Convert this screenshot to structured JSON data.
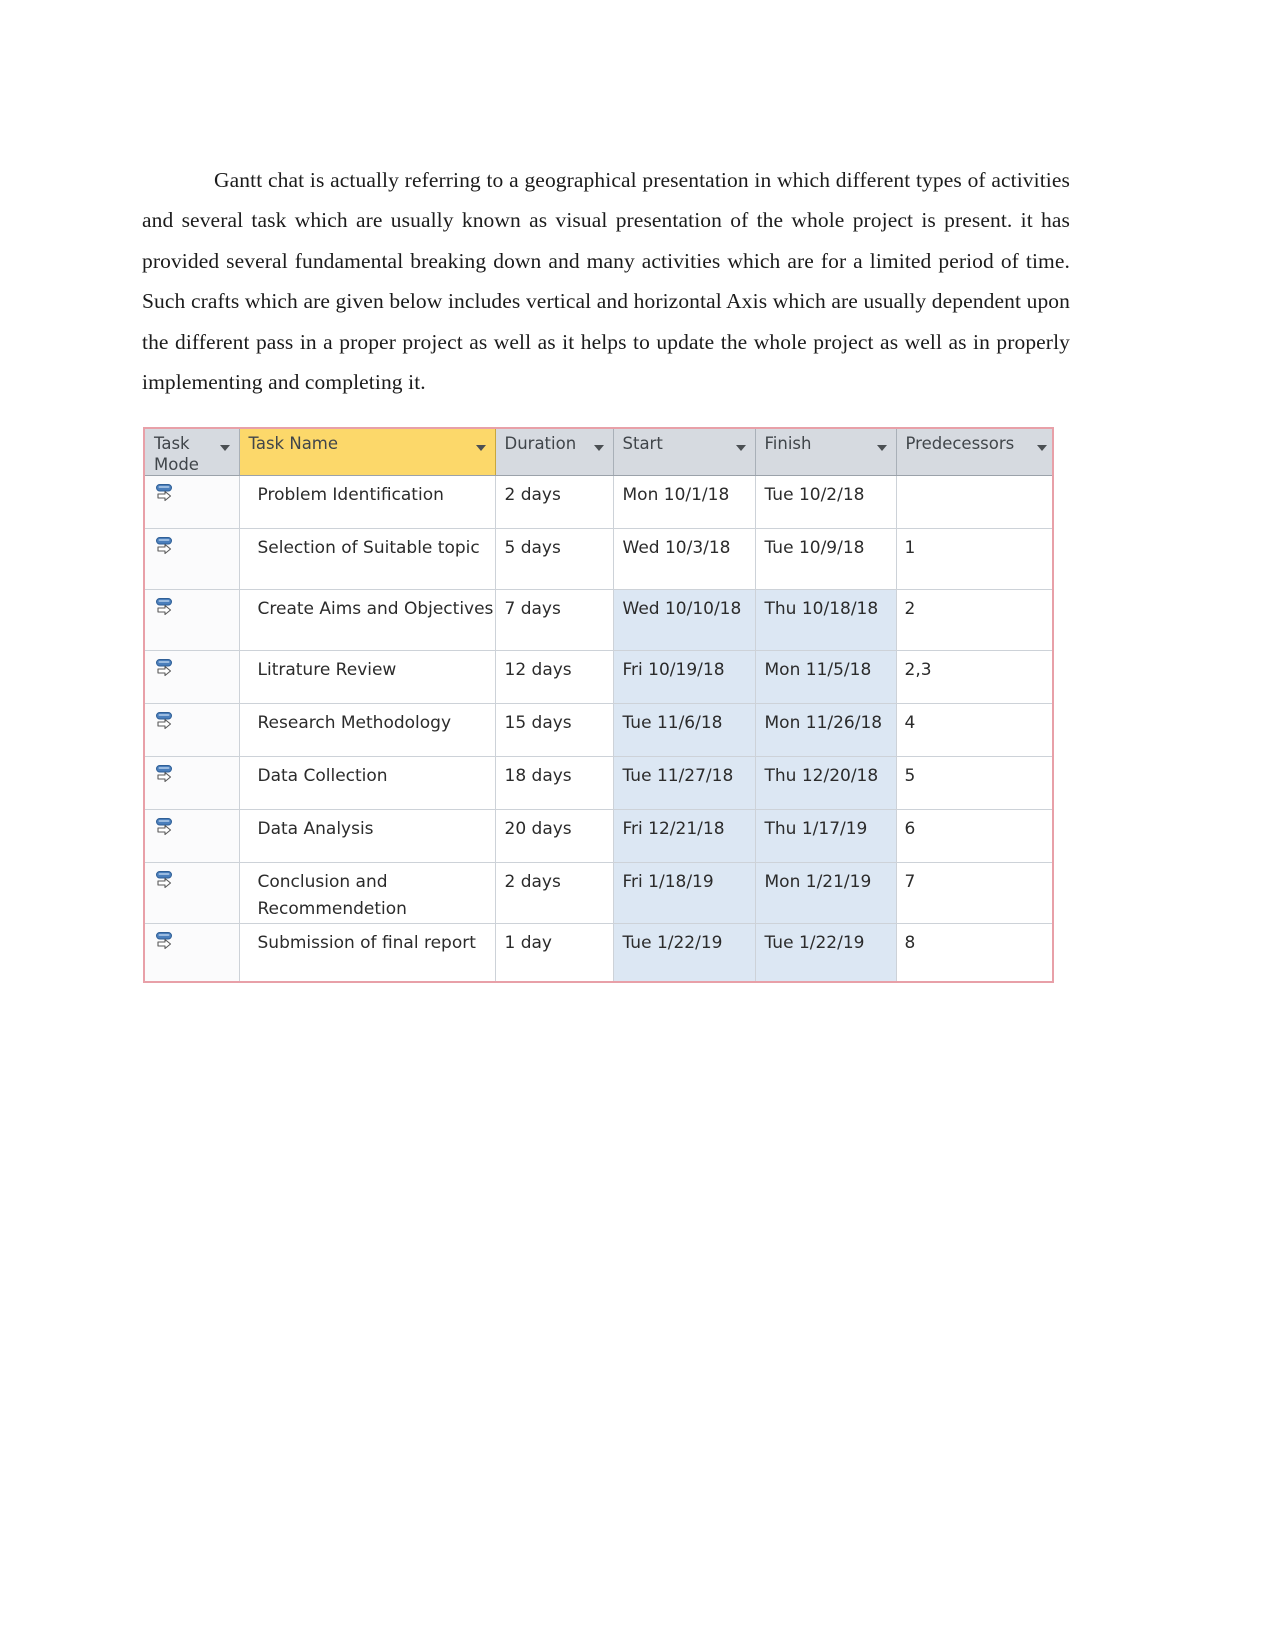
{
  "document": {
    "paragraph": "Gantt chat is actually referring to a geographical presentation in which different types of activities and several task which are usually known as visual presentation of the whole project is present. it has provided several fundamental breaking down and many activities which are for a limited period of time. Such crafts which are given below includes vertical and horizontal Axis which are usually dependent upon the different pass in a proper project as well as it helps to update the whole project as well as in properly implementing and completing it."
  },
  "project_table": {
    "columns": [
      {
        "key": "mode",
        "label": "Task\nMode",
        "has_filter": true,
        "highlighted": false
      },
      {
        "key": "name",
        "label": "Task Name",
        "has_filter": true,
        "highlighted": true
      },
      {
        "key": "duration",
        "label": "Duration",
        "has_filter": true,
        "highlighted": false
      },
      {
        "key": "start",
        "label": "Start",
        "has_filter": true,
        "highlighted": false
      },
      {
        "key": "finish",
        "label": "Finish",
        "has_filter": true,
        "highlighted": false
      },
      {
        "key": "predecessors",
        "label": "Predecessors",
        "has_filter": true,
        "highlighted": false
      }
    ],
    "colors": {
      "header_background": "#d6dae0",
      "task_name_header_background": "#fcd86a",
      "critical_date_tint": "#dce7f3",
      "border": "#e8a0a8",
      "mode_icon_blue": "#4a7ebb"
    },
    "mode_icon_name": "auto-scheduled-icon",
    "rows": [
      {
        "mode_icon": "auto-scheduled-icon",
        "name": "Problem Identification",
        "duration": "2 days",
        "start": "Mon 10/1/18",
        "finish": "Tue 10/2/18",
        "predecessors": "",
        "tinted": false,
        "lines": 1
      },
      {
        "mode_icon": "auto-scheduled-icon",
        "name": "Selection of Suitable topic",
        "duration": "5 days",
        "start": "Wed 10/3/18",
        "finish": "Tue 10/9/18",
        "predecessors": "1",
        "tinted": false,
        "lines": 2
      },
      {
        "mode_icon": "auto-scheduled-icon",
        "name": "Create Aims and Objectives",
        "duration": "7 days",
        "start": "Wed 10/10/18",
        "finish": "Thu 10/18/18",
        "predecessors": "2",
        "tinted": true,
        "lines": 2
      },
      {
        "mode_icon": "auto-scheduled-icon",
        "name": "Litrature Review",
        "duration": "12 days",
        "start": "Fri 10/19/18",
        "finish": "Mon 11/5/18",
        "predecessors": "2,3",
        "tinted": true,
        "lines": 1
      },
      {
        "mode_icon": "auto-scheduled-icon",
        "name": "Research Methodology",
        "duration": "15 days",
        "start": "Tue 11/6/18",
        "finish": "Mon 11/26/18",
        "predecessors": "4",
        "tinted": true,
        "lines": 1
      },
      {
        "mode_icon": "auto-scheduled-icon",
        "name": "Data Collection",
        "duration": "18 days",
        "start": "Tue 11/27/18",
        "finish": "Thu 12/20/18",
        "predecessors": "5",
        "tinted": true,
        "lines": 1
      },
      {
        "mode_icon": "auto-scheduled-icon",
        "name": "Data Analysis",
        "duration": "20 days",
        "start": "Fri 12/21/18",
        "finish": "Thu 1/17/19",
        "predecessors": "6",
        "tinted": true,
        "lines": 1
      },
      {
        "mode_icon": "auto-scheduled-icon",
        "name": "Conclusion and Recommendetion",
        "duration": "2 days",
        "start": "Fri 1/18/19",
        "finish": "Mon 1/21/19",
        "predecessors": "7",
        "tinted": true,
        "lines": 2
      },
      {
        "mode_icon": "auto-scheduled-icon",
        "name": "Submission of final report",
        "duration": "1 day",
        "start": "Tue 1/22/19",
        "finish": "Tue 1/22/19",
        "predecessors": "8",
        "tinted": true,
        "lines": 2
      }
    ]
  }
}
